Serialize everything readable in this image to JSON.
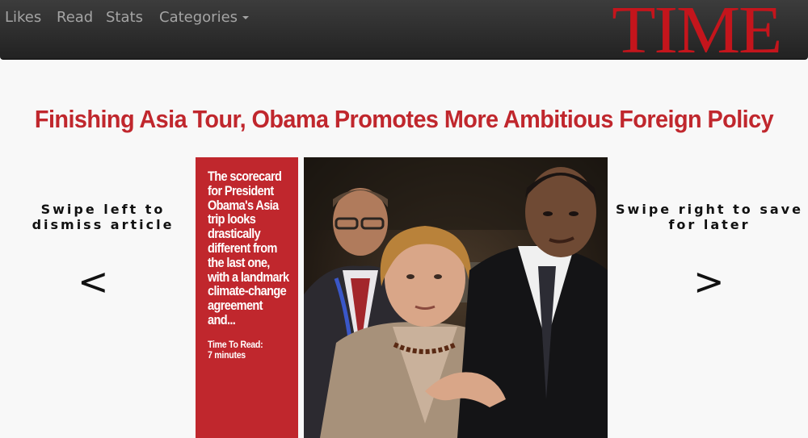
{
  "nav": {
    "items": [
      {
        "label": "Likes"
      },
      {
        "label": "Read"
      },
      {
        "label": "Stats"
      },
      {
        "label": "Categories"
      }
    ],
    "brand": "TIME"
  },
  "article": {
    "headline": "Finishing Asia Tour, Obama Promotes More Ambitious Foreign Policy",
    "summary": "The scorecard for President Obama's Asia trip looks drastically different from the last one, with a landmark climate-change agreement and...",
    "read_time_label": "Time To Read:",
    "read_time_value": "7 minutes"
  },
  "hints": {
    "left": "Swipe left to dismiss article",
    "right": "Swipe right to save for later",
    "left_arrow": "<",
    "right_arrow": ">"
  },
  "colors": {
    "brand_red": "#c4151c",
    "headline_red": "#c0272d",
    "navbar": "#2b2b2b",
    "nav_text": "#a4a4a4",
    "background": "#f8f8f8"
  },
  "icons": {
    "categories_caret": "caret-down-icon"
  }
}
